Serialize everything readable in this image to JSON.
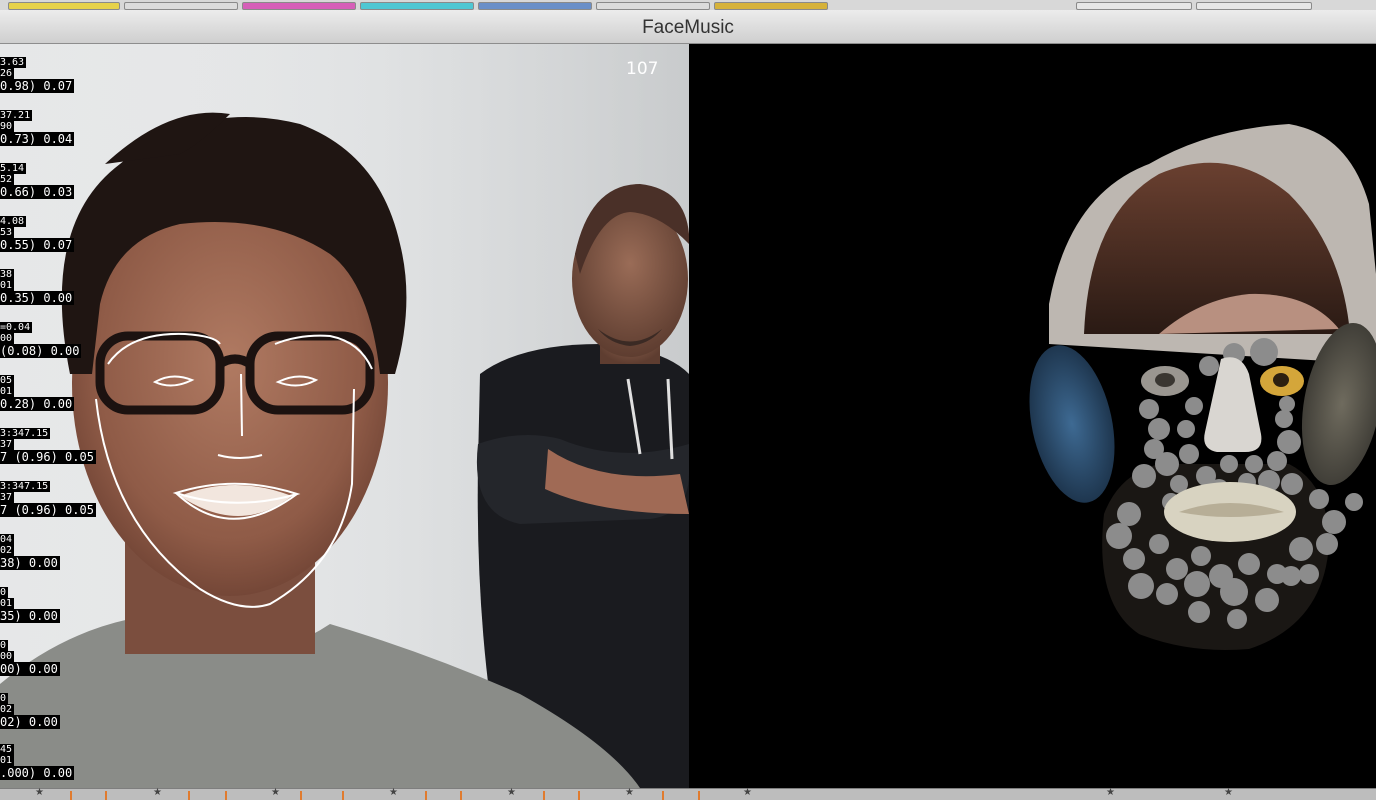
{
  "window": {
    "title": "FaceMusic"
  },
  "camera": {
    "frame_count": "107"
  },
  "debug_readouts": [
    [
      "3.63",
      "26",
      "0.98) 0.07"
    ],
    [
      "37.21",
      "90",
      "0.73) 0.04"
    ],
    [
      "5.14",
      "52",
      "0.66) 0.03"
    ],
    [
      "4.08",
      "53",
      "0.55) 0.07"
    ],
    [
      "38",
      "01",
      "0.35) 0.00"
    ],
    [
      "=0.04",
      "00",
      "(0.08) 0.00"
    ],
    [
      "05",
      "01",
      "0.28) 0.00"
    ],
    [
      "3:347.15",
      "37",
      "7 (0.96) 0.05"
    ],
    [
      "3:347.15",
      "37",
      "7 (0.96) 0.05"
    ],
    [
      "04",
      "02",
      "38) 0.00"
    ],
    [
      "0",
      "01",
      "35) 0.00"
    ],
    [
      "0",
      "00",
      "00) 0.00"
    ],
    [
      "0",
      "02",
      "02) 0.00"
    ],
    [
      "45",
      "01",
      ".000) 0.00"
    ]
  ],
  "colors": {
    "strip_segments": [
      "#e7d24a",
      "#d9d9d9",
      "#d65fb8",
      "#4fc7d3",
      "#6a8fc8",
      "#d9d9d9",
      "#d6b23a"
    ],
    "overlay_lines": "#ffffff",
    "background_output": "#000000"
  },
  "icons": {
    "face_mesh": "face-tracking-overlay",
    "collage": "face-collage-output"
  }
}
